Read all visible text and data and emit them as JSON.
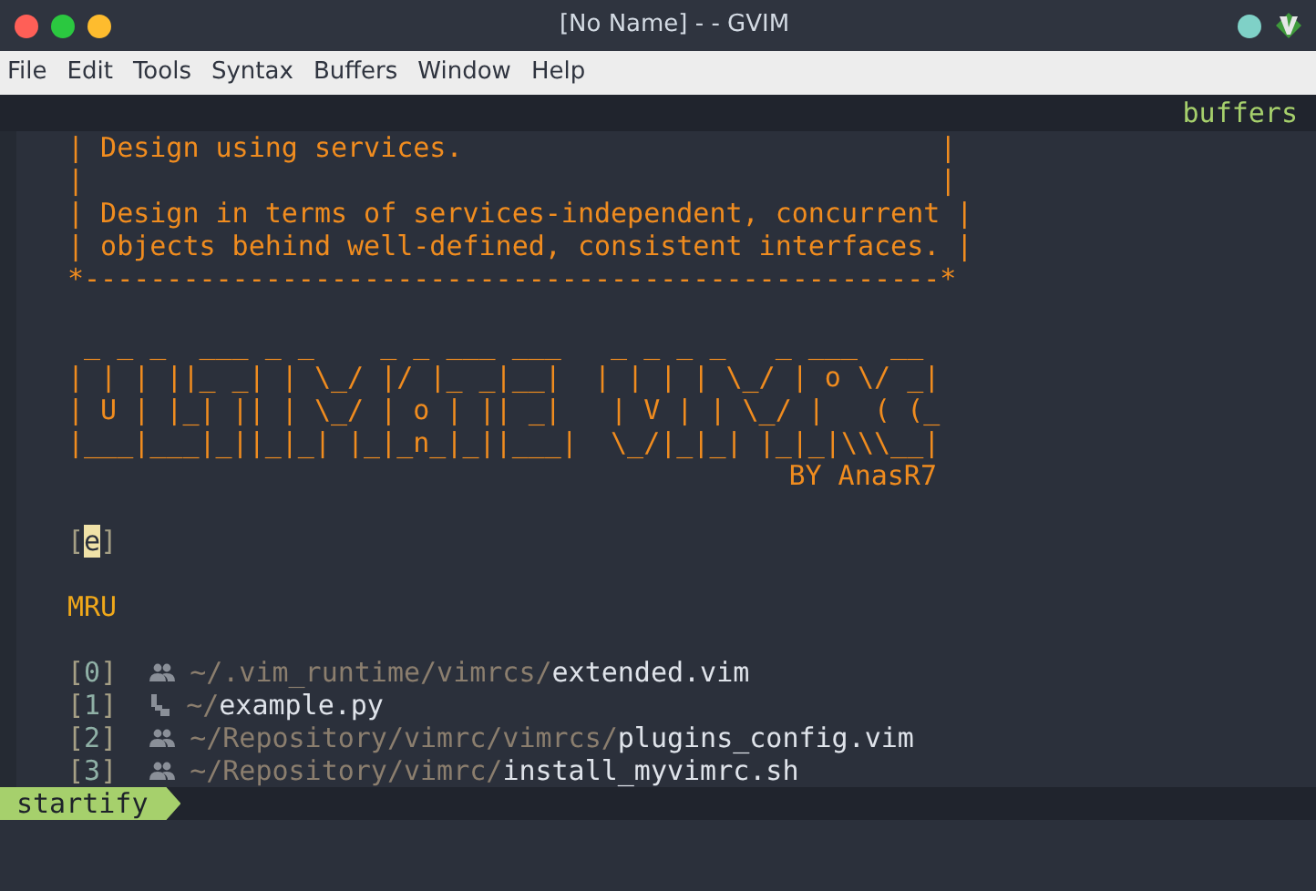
{
  "window": {
    "title": "[No Name] - - GVIM"
  },
  "menu": [
    "File",
    "Edit",
    "Tools",
    "Syntax",
    "Buffers",
    "Window",
    "Help"
  ],
  "tabline": {
    "label": "buffers"
  },
  "banner": [
    "| Design using services.                             |",
    "|                                                    |",
    "| Design in terms of services-independent, concurrent |",
    "| objects behind well-defined, consistent interfaces. |",
    "*----------------------------------------------------*"
  ],
  "art": [
    " _ _ _  ___ _ _    _ _ ___ ___   _ _ _ _   _ ___  __",
    "| | | ||_ _| | \\_/ |/ |_ _|__|  | | | | \\_/ | o \\/ _|",
    "| U | |_| || | \\_/ | o | || _|   | V | | \\_/ |   ( (_",
    "|___|___|_||_|_| |_|_n_|_||___|  \\_/|_|_| |_|_|\\\\\\__|"
  ],
  "byline": "BY AnasR7",
  "empty_buffer": {
    "open": "[",
    "key": "e",
    "close": "]",
    "cursor": true
  },
  "section": "MRU",
  "files": [
    {
      "index": "[0]",
      "kind": "shared",
      "dir": "~/.vim_runtime/vimrcs/",
      "file": "extended.vim"
    },
    {
      "index": "[1]",
      "kind": "python",
      "dir": "~/",
      "file": "example.py"
    },
    {
      "index": "[2]",
      "kind": "shared",
      "dir": "~/Repository/vimrc/vimrcs/",
      "file": "plugins_config.vim"
    },
    {
      "index": "[3]",
      "kind": "shared",
      "dir": "~/Repository/vimrc/",
      "file": "install_myvimrc.sh"
    }
  ],
  "statusline": {
    "mode": "startify"
  }
}
